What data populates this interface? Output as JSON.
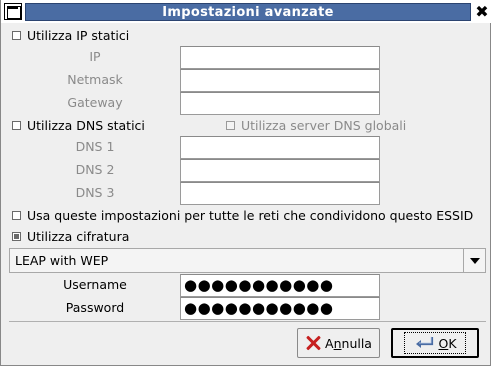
{
  "window": {
    "title": "Impostazioni avanzate",
    "close_glyph": "✖"
  },
  "static_ip": {
    "checkbox_label": "Utilizza IP statici",
    "checked": false,
    "fields": [
      {
        "label": "IP",
        "value": ""
      },
      {
        "label": "Netmask",
        "value": ""
      },
      {
        "label": "Gateway",
        "value": ""
      }
    ]
  },
  "static_dns": {
    "checkbox_label": "Utilizza DNS statici",
    "checked": false,
    "global_dns_label": "Utilizza server DNS globali",
    "global_dns_checked": false,
    "fields": [
      {
        "label": "DNS 1",
        "value": ""
      },
      {
        "label": "DNS 2",
        "value": ""
      },
      {
        "label": "DNS 3",
        "value": ""
      }
    ]
  },
  "essid_settings": {
    "checkbox_label": "Usa queste impostazioni per tutte le reti che condividono questo ESSID",
    "checked": false
  },
  "encryption": {
    "checkbox_label": "Utilizza cifratura",
    "checked": true,
    "type_selected": "LEAP with WEP",
    "username_label": "Username",
    "username_value": "●●●●●●●●●●●",
    "password_label": "Password",
    "password_value": "●●●●●●●●●●●"
  },
  "buttons": {
    "cancel_prefix": "A",
    "cancel_mnemonic": "n",
    "cancel_rest": "nulla",
    "ok_mnemonic": "O",
    "ok_rest": "K"
  },
  "colors": {
    "title_bar": "#4a6ca3",
    "window_bg": "#efefef",
    "cancel_icon": "#c62020"
  }
}
